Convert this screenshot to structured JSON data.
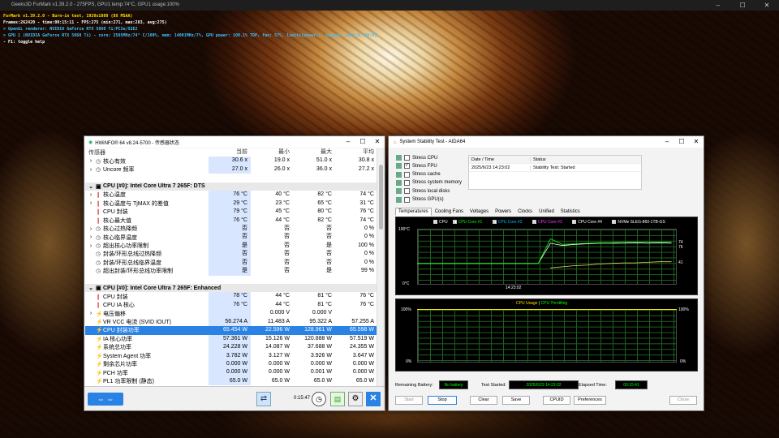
{
  "taskbar_title": "Geeks3D FurMark v1.39.2.0 - 275FPS, GPU1 temp:74°C, GPU1 usage:100%",
  "osd": [
    {
      "t": "FurMark v1.39.2.0 - Burn-in test, 1920x1080 (8X MSAA)",
      "c": "#ffe000"
    },
    {
      "t": "Frames:262420 - time:00:15:11 - FPS:275 (min:271, max:283, avg:275)",
      "c": "#ffffff"
    },
    {
      "t": "> OpenGL renderer: NVIDIA GeForce RTX 5060 Ti/PCIe/SSE2",
      "c": "#40c0ff"
    },
    {
      "t": "> GPU 1 (NVIDIA GeForce RTX 5060 Ti) - core: 2505MHz/74° C/100%, mem: 14001MHz/7%, GPU power: 100.1% TDP, fan: 57%, limits[power:1, temp:0, volt:0, OV:0]",
      "c": "#40c0ff"
    },
    {
      "t": "- F1: toggle help",
      "c": "#ffffff"
    }
  ],
  "hwinfo": {
    "title": "HWiNFO® 64 v8.24-5700 - 传感器状态",
    "cols": [
      "传感器",
      "当前",
      "最小",
      "最大",
      "平均"
    ],
    "rows": [
      {
        "k": "r",
        "exp": "›",
        "icon": "◷",
        "name": "核心有效",
        "v": [
          "30.6 x",
          "19.0 x",
          "51.0 x",
          "30.8 x"
        ]
      },
      {
        "k": "r",
        "exp": "›",
        "icon": "◷",
        "name": "Uncore 频率",
        "v": [
          "27.0 x",
          "26.0 x",
          "36.0 x",
          "27.2 x"
        ]
      },
      {
        "k": "g"
      },
      {
        "k": "s",
        "name": "CPU [#0]: Intel Core Ultra 7 265F: DTS"
      },
      {
        "k": "r",
        "exp": "›",
        "icon": "🌡",
        "name": "核心温度",
        "v": [
          "76 °C",
          "40 °C",
          "82 °C",
          "74 °C"
        ]
      },
      {
        "k": "r",
        "exp": "›",
        "icon": "🌡",
        "name": "核心温度与 TjMAX 的差值",
        "v": [
          "29 °C",
          "23 °C",
          "65 °C",
          "31 °C"
        ]
      },
      {
        "k": "r",
        "exp": "",
        "icon": "🌡",
        "name": "CPU 封装",
        "v": [
          "79 °C",
          "45 °C",
          "80 °C",
          "76 °C"
        ]
      },
      {
        "k": "r",
        "exp": "",
        "icon": "🌡",
        "name": "核心最大值",
        "v": [
          "76 °C",
          "44 °C",
          "82 °C",
          "74 °C"
        ]
      },
      {
        "k": "r",
        "exp": "›",
        "icon": "◷",
        "name": "核心过热降频",
        "v": [
          "否",
          "否",
          "否",
          "0 %"
        ]
      },
      {
        "k": "r",
        "exp": "›",
        "icon": "◷",
        "name": "核心临界温度",
        "v": [
          "否",
          "否",
          "否",
          "0 %"
        ]
      },
      {
        "k": "r",
        "exp": "›",
        "icon": "◷",
        "name": "超出核心功率限制",
        "v": [
          "是",
          "否",
          "是",
          "100 %"
        ]
      },
      {
        "k": "r",
        "exp": "",
        "icon": "◷",
        "name": "封装/环形总线过热降频",
        "v": [
          "否",
          "否",
          "否",
          "0 %"
        ]
      },
      {
        "k": "r",
        "exp": "",
        "icon": "◷",
        "name": "封装/环形总线临界温度",
        "v": [
          "否",
          "否",
          "否",
          "0 %"
        ]
      },
      {
        "k": "r",
        "exp": "",
        "icon": "◷",
        "name": "超出封装/环形总线功率限制",
        "v": [
          "是",
          "否",
          "是",
          "99 %"
        ]
      },
      {
        "k": "g"
      },
      {
        "k": "s",
        "name": "CPU [#0]: Intel Core Ultra 7 265F: Enhanced"
      },
      {
        "k": "r",
        "exp": "",
        "icon": "🌡",
        "name": "CPU 封装",
        "v": [
          "78 °C",
          "44 °C",
          "81 °C",
          "76 °C"
        ]
      },
      {
        "k": "r",
        "exp": "",
        "icon": "🌡",
        "name": "CPU IA 核心",
        "v": [
          "76 °C",
          "44 °C",
          "81 °C",
          "76 °C"
        ]
      },
      {
        "k": "r",
        "exp": "›",
        "icon": "⚡",
        "name": "电压偏移",
        "v": [
          "",
          "0.000 V",
          "0.000 V",
          ""
        ]
      },
      {
        "k": "r",
        "exp": "",
        "icon": "⚡",
        "name": "VR VCC 电流 (SVID IOUT)",
        "v": [
          "56.274 A",
          "11.483 A",
          "95.322 A",
          "57.255 A"
        ]
      },
      {
        "k": "r",
        "exp": "",
        "icon": "⚡",
        "name": "CPU 封装功率",
        "v": [
          "65.454 W",
          "22.596 W",
          "128.961 W",
          "65.598 W"
        ],
        "sel": true
      },
      {
        "k": "r",
        "exp": "",
        "icon": "⚡",
        "name": "IA 核心功率",
        "v": [
          "57.361 W",
          "15.126 W",
          "120.888 W",
          "57.519 W"
        ]
      },
      {
        "k": "r",
        "exp": "",
        "icon": "⚡",
        "name": "系统总功率",
        "v": [
          "24.228 W",
          "14.087 W",
          "37.688 W",
          "24.355 W"
        ]
      },
      {
        "k": "r",
        "exp": "",
        "icon": "⚡",
        "name": "System Agent 功率",
        "v": [
          "3.782 W",
          "3.127 W",
          "3.926 W",
          "3.647 W"
        ]
      },
      {
        "k": "r",
        "exp": "",
        "icon": "⚡",
        "name": "剩余芯片功率",
        "v": [
          "0.000 W",
          "0.000 W",
          "0.000 W",
          "0.000 W"
        ]
      },
      {
        "k": "r",
        "exp": "",
        "icon": "⚡",
        "name": "PCH 功率",
        "v": [
          "0.000 W",
          "0.000 W",
          "0.001 W",
          "0.000 W"
        ]
      },
      {
        "k": "r",
        "exp": "",
        "icon": "⚡",
        "name": "PL1 功率限制 (静态)",
        "v": [
          "65.0 W",
          "65.0 W",
          "65.0 W",
          "65.0 W"
        ]
      }
    ],
    "timer": "0:15:47"
  },
  "sst": {
    "title": "System Stability Test - AIDA64",
    "checks": [
      {
        "label": "Stress CPU",
        "on": false
      },
      {
        "label": "Stress FPU",
        "on": true
      },
      {
        "label": "Stress cache",
        "on": false
      },
      {
        "label": "Stress system memory",
        "on": false
      },
      {
        "label": "Stress local disks",
        "on": false
      },
      {
        "label": "Stress GPU(s)",
        "on": false
      }
    ],
    "status_head": [
      "Date / Time",
      "Status"
    ],
    "status_row": [
      "2025/6/23 14:23:02",
      "Stability Test: Started"
    ],
    "tabs": [
      "Temperatures",
      "Cooling Fans",
      "Voltages",
      "Powers",
      "Clocks",
      "Unified",
      "Statistics"
    ],
    "legend": [
      {
        "label": "CPU",
        "color": "#ffffff"
      },
      {
        "label": "CPU Core #1",
        "color": "#00ff00"
      },
      {
        "label": "CPU Core #2",
        "color": "#00c0ff"
      },
      {
        "label": "CPU Core #3",
        "color": "#ff40ff"
      },
      {
        "label": "CPU Core #4",
        "color": "#ffffff"
      },
      {
        "label": "NVMe SLEG-860-1TB-GS",
        "color": "#ffffff"
      }
    ],
    "ax1_top": "100°C",
    "ax1_bot": "0°C",
    "ax1_time": "14:23:02",
    "ax1_right": [
      "74",
      "76",
      "41"
    ],
    "chart2_title_a": "CPU Usage",
    "chart2_sep": "|",
    "chart2_title_b": "CPU Throttling",
    "ax2_top": "100%",
    "ax2_bot": "0%",
    "ax2_right_top": "100%",
    "ax2_right_bot": "0%",
    "rb_label": "Remaining Battery:",
    "rb_value": "No battery",
    "ts_label": "Test Started:",
    "ts_value": "2025/6/23 14:23:02",
    "et_label": "Elapsed Time:",
    "et_value": "00:15:41",
    "buttons": [
      "Start",
      "Stop",
      "Clear",
      "Save",
      "CPUID",
      "Preferences",
      "Close"
    ]
  },
  "chart_data": {
    "type": "line",
    "series": [
      {
        "name": "CPU",
        "values": [
          38,
          38,
          38,
          38,
          38,
          38,
          38,
          38,
          38,
          38,
          38,
          74,
          70,
          72,
          73,
          74,
          74,
          74,
          75,
          74,
          75,
          74
        ]
      },
      {
        "name": "CPU Core #1",
        "values": [
          38,
          38,
          38,
          38,
          38,
          38,
          38,
          38,
          38,
          38,
          38,
          82,
          72,
          73,
          74,
          75,
          75,
          76,
          76,
          76,
          76,
          76
        ]
      },
      {
        "name": "NVMe SLEG-860-1TB-GS",
        "values": [
          null,
          null,
          null,
          null,
          null,
          null,
          null,
          null,
          null,
          null,
          null,
          30,
          32,
          34,
          35,
          37,
          38,
          39,
          39,
          40,
          41,
          41
        ]
      }
    ],
    "ylim": [
      0,
      100
    ]
  }
}
